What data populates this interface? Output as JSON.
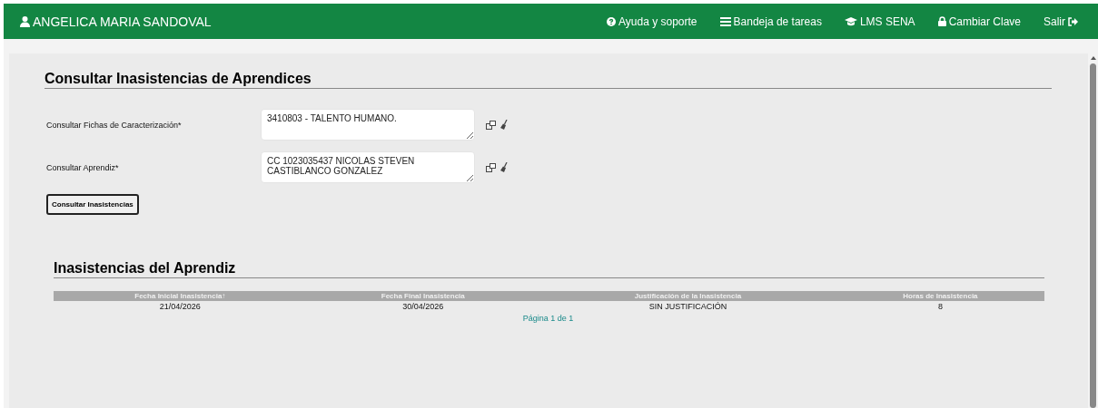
{
  "header": {
    "user": "ANGELICA MARIA SANDOVAL",
    "nav": [
      {
        "label": "Ayuda y soporte",
        "kind": "help"
      },
      {
        "label": "Bandeja de tareas",
        "kind": "tasks"
      },
      {
        "label": "LMS SENA",
        "kind": "learning"
      },
      {
        "label": "Cambiar Clave",
        "kind": "password"
      },
      {
        "label": "Salir",
        "kind": "logout"
      }
    ]
  },
  "form": {
    "title": "Consultar Inasistencias de Aprendices",
    "fields": [
      {
        "label": "Consultar Fichas de Caracterización*",
        "value": "3410803 - TALENTO HUMANO."
      },
      {
        "label": "Consultar Aprendiz*",
        "value": "CC 1023035437 NICOLAS STEVEN CASTIBLANCO GONZALEZ"
      }
    ],
    "button": "Consultar Inasistencias"
  },
  "results": {
    "title": "Inasistencias del Aprendiz",
    "table": {
      "columns": [
        "Fecha Inicial Inasistencia↑",
        "Fecha Final Inasistencia",
        "Justificación de la Inasistencia",
        "Horas de Inasistencia"
      ],
      "rows": [
        [
          "21/04/2026",
          "30/04/2026",
          "SIN JUSTIFICACIÓN",
          "8"
        ]
      ]
    },
    "pager": "Página 1 de 1"
  }
}
